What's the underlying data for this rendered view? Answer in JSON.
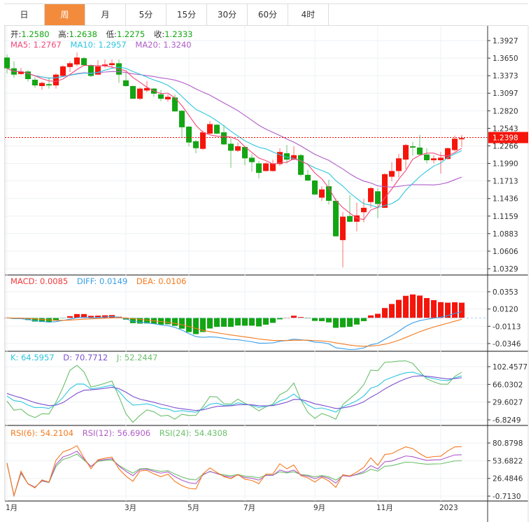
{
  "tabs": [
    {
      "label": "日",
      "active": false
    },
    {
      "label": "周",
      "active": true
    },
    {
      "label": "月",
      "active": false
    },
    {
      "label": "5分",
      "active": false
    },
    {
      "label": "15分",
      "active": false
    },
    {
      "label": "30分",
      "active": false
    },
    {
      "label": "60分",
      "active": false
    },
    {
      "label": "4时",
      "active": false
    }
  ],
  "ohlc_legend": {
    "open_label": "开:",
    "open": "1.2580",
    "high_label": "高:",
    "high": "1.2638",
    "low_label": "低:",
    "low": "1.2275",
    "close_label": "收:",
    "close": "1.2333"
  },
  "ma_legend": {
    "ma5": "MA5: 1.2767",
    "ma10": "MA10: 1.2957",
    "ma20": "MA20: 1.3240"
  },
  "macd_legend": {
    "macd": "MACD: 0.0085",
    "diff": "DIFF: 0.0149",
    "dea": "DEA: 0.0106"
  },
  "kdj_legend": {
    "k": "K: 64.5957",
    "d": "D: 70.7712",
    "j": "J: 52.2447"
  },
  "rsi_legend": {
    "rsi6": "RSI(6): 54.2104",
    "rsi12": "RSI(12): 56.6906",
    "rsi24": "RSI(24): 54.4308"
  },
  "colors": {
    "up": "#f5150b",
    "down": "#13a513",
    "ma5": "#f0487a",
    "ma10": "#2ec6de",
    "ma20": "#b05cc8",
    "diff": "#3a9ee8",
    "dea": "#f57a1e",
    "k": "#2ec6de",
    "d": "#7b4fcf",
    "j": "#6cc06c",
    "rsi6": "#f57a1e",
    "rsi12": "#b05cc8",
    "rsi24": "#6cc06c",
    "accent": "#f28c3c"
  },
  "chart_data": {
    "type": "candlestick",
    "title": "",
    "last_price": "1.2398",
    "x_labels": [
      {
        "index": 0,
        "label": "1月"
      },
      {
        "index": 17,
        "label": "3月"
      },
      {
        "index": 26,
        "label": "5月"
      },
      {
        "index": 34,
        "label": "7月"
      },
      {
        "index": 44,
        "label": "9月"
      },
      {
        "index": 53,
        "label": "11月"
      },
      {
        "index": 62,
        "label": "2023"
      }
    ],
    "price_axis": {
      "range": [
        1.023,
        1.4159
      ],
      "ticks": [
        "1.3927",
        "1.3650",
        "1.3373",
        "1.3097",
        "1.2820",
        "1.2543",
        "1.2266",
        "1.1990",
        "1.1713",
        "1.1436",
        "1.1159",
        "1.0883",
        "1.0606",
        "1.0329"
      ]
    },
    "macd_axis": {
      "range": [
        -0.045,
        0.0579
      ],
      "ticks": [
        "0.0353",
        "0.0120",
        "-0.0113",
        "-0.0346"
      ]
    },
    "kdj_axis": {
      "range": [
        -18.3,
        134.1
      ],
      "ticks": [
        "102.4577",
        "66.0302",
        "29.6027",
        "-6.8249"
      ]
    },
    "rsi_axis": {
      "range": [
        -8.2,
        107.8
      ],
      "ticks": [
        "80.8798",
        "53.6822",
        "26.4846",
        "-0.7130"
      ]
    },
    "ohlc": [
      [
        1.366,
        1.371,
        1.341,
        1.349
      ],
      [
        1.349,
        1.36,
        1.334,
        1.339
      ],
      [
        1.34,
        1.35,
        1.339,
        1.344
      ],
      [
        1.344,
        1.346,
        1.328,
        1.332
      ],
      [
        1.331,
        1.335,
        1.318,
        1.322
      ],
      [
        1.321,
        1.328,
        1.315,
        1.326
      ],
      [
        1.324,
        1.335,
        1.317,
        1.322
      ],
      [
        1.322,
        1.341,
        1.317,
        1.339
      ],
      [
        1.337,
        1.354,
        1.335,
        1.352
      ],
      [
        1.351,
        1.36,
        1.343,
        1.357
      ],
      [
        1.355,
        1.374,
        1.352,
        1.366
      ],
      [
        1.365,
        1.367,
        1.353,
        1.354
      ],
      [
        1.354,
        1.355,
        1.335,
        1.337
      ],
      [
        1.339,
        1.362,
        1.339,
        1.352
      ],
      [
        1.353,
        1.363,
        1.35,
        1.355
      ],
      [
        1.354,
        1.363,
        1.349,
        1.357
      ],
      [
        1.357,
        1.363,
        1.326,
        1.339
      ],
      [
        1.33,
        1.343,
        1.32,
        1.321
      ],
      [
        1.321,
        1.322,
        1.301,
        1.301
      ],
      [
        1.301,
        1.319,
        1.299,
        1.317
      ],
      [
        1.314,
        1.329,
        1.311,
        1.318
      ],
      [
        1.317,
        1.318,
        1.304,
        1.309
      ],
      [
        1.308,
        1.315,
        1.297,
        1.301
      ],
      [
        1.3,
        1.308,
        1.296,
        1.304
      ],
      [
        1.303,
        1.308,
        1.281,
        1.281
      ],
      [
        1.282,
        1.283,
        1.239,
        1.256
      ],
      [
        1.257,
        1.258,
        1.226,
        1.232
      ],
      [
        1.234,
        1.236,
        1.215,
        1.223
      ],
      [
        1.222,
        1.251,
        1.22,
        1.248
      ],
      [
        1.246,
        1.266,
        1.245,
        1.261
      ],
      [
        1.26,
        1.261,
        1.245,
        1.246
      ],
      [
        1.248,
        1.26,
        1.228,
        1.229
      ],
      [
        1.23,
        1.239,
        1.192,
        1.219
      ],
      [
        1.219,
        1.232,
        1.217,
        1.226
      ],
      [
        1.225,
        1.225,
        1.196,
        1.207
      ],
      [
        1.208,
        1.214,
        1.186,
        1.201
      ],
      [
        1.199,
        1.203,
        1.175,
        1.184
      ],
      [
        1.187,
        1.201,
        1.186,
        1.199
      ],
      [
        1.187,
        1.205,
        1.186,
        1.199
      ],
      [
        1.198,
        1.223,
        1.195,
        1.217
      ],
      [
        1.215,
        1.228,
        1.199,
        1.205
      ],
      [
        1.205,
        1.226,
        1.204,
        1.212
      ],
      [
        1.212,
        1.214,
        1.178,
        1.181
      ],
      [
        1.181,
        1.189,
        1.171,
        1.172
      ],
      [
        1.172,
        1.173,
        1.149,
        1.15
      ],
      [
        1.145,
        1.163,
        1.14,
        1.158
      ],
      [
        1.163,
        1.173,
        1.134,
        1.14
      ],
      [
        1.14,
        1.144,
        1.084,
        1.084
      ],
      [
        1.078,
        1.122,
        1.035,
        1.115
      ],
      [
        1.116,
        1.149,
        1.106,
        1.107
      ],
      [
        1.107,
        1.137,
        1.092,
        1.117
      ],
      [
        1.122,
        1.143,
        1.106,
        1.129
      ],
      [
        1.138,
        1.162,
        1.129,
        1.16
      ],
      [
        1.155,
        1.16,
        1.113,
        1.135
      ],
      [
        1.129,
        1.184,
        1.129,
        1.182
      ],
      [
        1.178,
        1.201,
        1.171,
        1.187
      ],
      [
        1.187,
        1.214,
        1.177,
        1.207
      ],
      [
        1.205,
        1.23,
        1.19,
        1.228
      ],
      [
        1.226,
        1.233,
        1.211,
        1.224
      ],
      [
        1.224,
        1.244,
        1.212,
        1.213
      ],
      [
        1.213,
        1.223,
        1.199,
        1.204
      ],
      [
        1.204,
        1.212,
        1.199,
        1.207
      ],
      [
        1.204,
        1.217,
        1.183,
        1.208
      ],
      [
        1.206,
        1.224,
        1.205,
        1.223
      ],
      [
        1.22,
        1.243,
        1.218,
        1.238
      ],
      [
        1.237,
        1.244,
        1.225,
        1.239
      ]
    ]
  }
}
